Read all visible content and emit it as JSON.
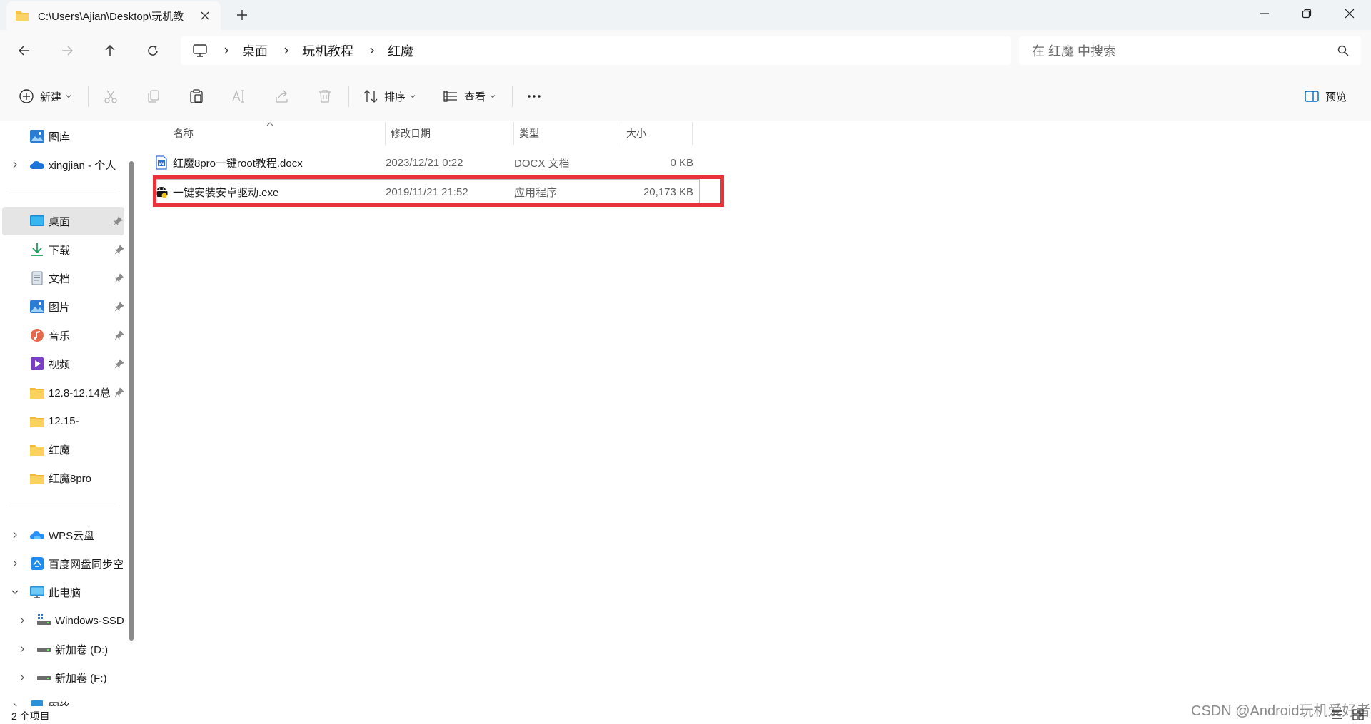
{
  "window": {
    "tab_title": "C:\\Users\\Ajian\\Desktop\\玩机教",
    "controls": [
      "minimize-icon",
      "restore-icon",
      "close-icon"
    ]
  },
  "address": {
    "crumbs": [
      "桌面",
      "玩机教程",
      "红魔"
    ],
    "search_placeholder": "在 红魔 中搜索"
  },
  "commands": {
    "new_label": "新建",
    "sort_label": "排序",
    "view_label": "查看",
    "preview_label": "预览"
  },
  "sidebar": {
    "items": [
      {
        "label": "图库",
        "icon": "gallery-icon"
      },
      {
        "label": "xingjian - 个人",
        "icon": "onedrive-icon"
      },
      {
        "label": "桌面",
        "icon": "desktop-icon",
        "selected": true,
        "pinned": true
      },
      {
        "label": "下载",
        "icon": "download-icon",
        "pinned": true
      },
      {
        "label": "文档",
        "icon": "document-icon",
        "pinned": true
      },
      {
        "label": "图片",
        "icon": "pictures-icon",
        "pinned": true
      },
      {
        "label": "音乐",
        "icon": "music-icon",
        "pinned": true
      },
      {
        "label": "视频",
        "icon": "video-icon",
        "pinned": true
      },
      {
        "label": "12.8-12.14总",
        "icon": "folder-icon",
        "pinned": true
      },
      {
        "label": "12.15-",
        "icon": "folder-icon"
      },
      {
        "label": "红魔",
        "icon": "folder-icon"
      },
      {
        "label": "红魔8pro",
        "icon": "folder-icon"
      },
      {
        "label": "WPS云盘",
        "icon": "wps-cloud-icon"
      },
      {
        "label": "百度网盘同步空",
        "icon": "baidu-netdisk-icon"
      },
      {
        "label": "此电脑",
        "icon": "this-pc-icon"
      },
      {
        "label": "Windows-SSD",
        "icon": "drive-icon"
      },
      {
        "label": "新加卷 (D:)",
        "icon": "drive-icon"
      },
      {
        "label": "新加卷 (F:)",
        "icon": "drive-icon"
      },
      {
        "label": "网络",
        "icon": "network-icon"
      }
    ]
  },
  "table": {
    "columns": [
      "名称",
      "修改日期",
      "类型",
      "大小"
    ],
    "rows": [
      {
        "name": "红魔8pro一键root教程.docx",
        "date": "2023/12/21 0:22",
        "type": "DOCX 文档",
        "size": "0 KB",
        "icon": "word-doc-icon"
      },
      {
        "name": "一键安装安卓驱动.exe",
        "date": "2019/11/21 21:52",
        "type": "应用程序",
        "size": "20,173 KB",
        "icon": "android-exe-icon"
      }
    ]
  },
  "status": {
    "count_text": "2 个项目",
    "watermark": "CSDN @Android玩机爱好者"
  },
  "colors": {
    "highlight": "#e8333a",
    "selected_bg": "#e5e5e5",
    "accent": "#0067c0"
  }
}
